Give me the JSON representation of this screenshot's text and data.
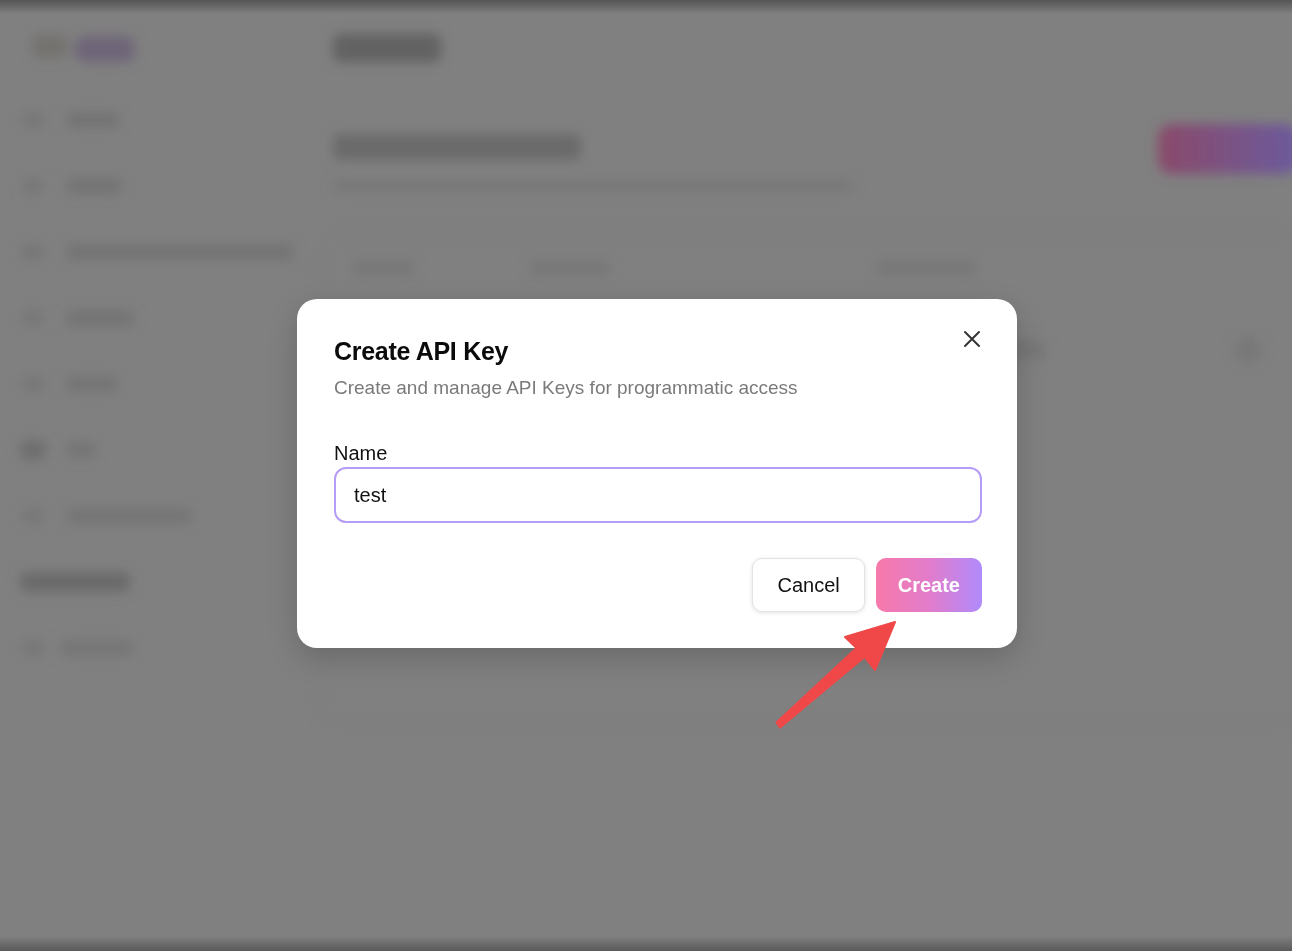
{
  "dialog": {
    "title": "Create API Key",
    "subtitle": "Create and manage API Keys for programmatic access",
    "field": {
      "label": "Name",
      "value": "test",
      "focused": true
    },
    "buttons": [
      {
        "label": "Cancel",
        "kind": "secondary"
      },
      {
        "label": "Create",
        "kind": "primary"
      }
    ]
  }
}
